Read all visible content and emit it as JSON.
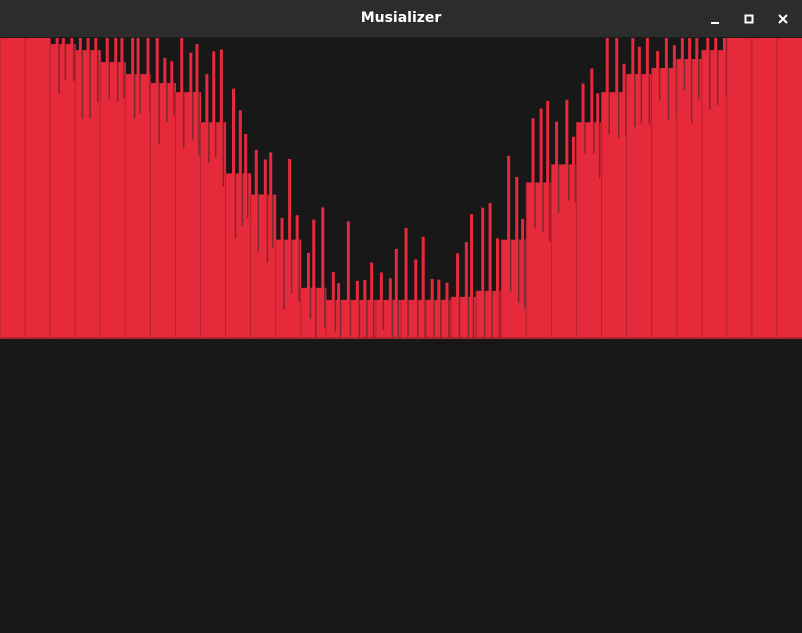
{
  "window": {
    "title": "Musializer",
    "controls": {
      "minimize": "minimize-icon",
      "maximize": "maximize-icon",
      "close": "close-icon"
    }
  },
  "colors": {
    "titlebar": "#2c2c2c",
    "background": "#181818",
    "bar": "#e62a3c",
    "peak_line": "#7a2a32",
    "divider": "#b0222f"
  },
  "visualizer": {
    "bands": 32,
    "band_levels": [
      1.0,
      1.0,
      0.98,
      0.96,
      0.92,
      0.88,
      0.85,
      0.82,
      0.72,
      0.55,
      0.48,
      0.33,
      0.17,
      0.13,
      0.13,
      0.13,
      0.13,
      0.13,
      0.14,
      0.16,
      0.33,
      0.52,
      0.58,
      0.72,
      0.82,
      0.88,
      0.9,
      0.93,
      0.96,
      1.0,
      1.0,
      1.0
    ]
  }
}
